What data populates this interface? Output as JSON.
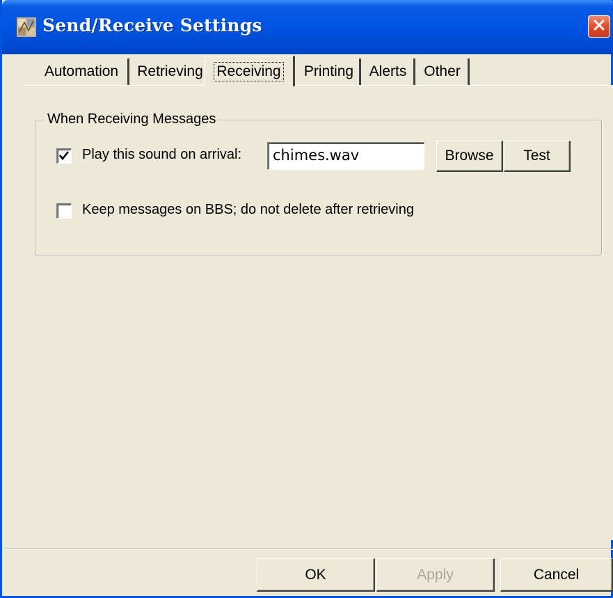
{
  "window": {
    "title": "Send/Receive Settings",
    "close_icon": "close-x-icon",
    "app_icon": "app-icon"
  },
  "tabs": [
    {
      "label": "Automation",
      "active": false
    },
    {
      "label": "Retrieving",
      "active": false
    },
    {
      "label": "Receiving",
      "active": true
    },
    {
      "label": "Printing",
      "active": false
    },
    {
      "label": "Alerts",
      "active": false
    },
    {
      "label": "Other",
      "active": false
    }
  ],
  "receiving": {
    "group_title": "When Receiving Messages",
    "play_sound": {
      "label": "Play this sound on arrival:",
      "checked": true
    },
    "sound_file": {
      "value": "chimes.wav"
    },
    "browse_label": "Browse",
    "test_label": "Test",
    "keep_messages": {
      "label": "Keep messages on BBS; do not delete after retrieving",
      "checked": false
    }
  },
  "footer": {
    "ok_label": "OK",
    "apply_label": "Apply",
    "apply_enabled": false,
    "cancel_label": "Cancel"
  },
  "colors": {
    "titlebar": "#0054E3",
    "dialog_bg": "#ECE9D8",
    "close_button": "#E0522E",
    "disabled_text": "#ACA899"
  }
}
